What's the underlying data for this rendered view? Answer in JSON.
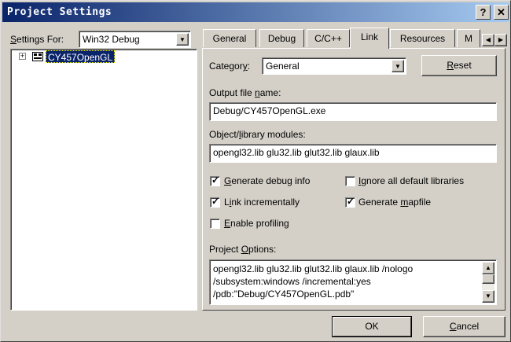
{
  "window": {
    "title": "Project Settings",
    "help": "?",
    "close": "✕"
  },
  "settings_for": {
    "label": "Settings For:",
    "value": "Win32 Debug"
  },
  "tree": {
    "expand": "+",
    "root": "CY457OpenGL"
  },
  "tabs": [
    {
      "label": "General"
    },
    {
      "label": "Debug"
    },
    {
      "label": "C/C++"
    },
    {
      "label": "Link"
    },
    {
      "label": "Resources"
    },
    {
      "label": "M"
    }
  ],
  "tab_scroll": {
    "left": "◀",
    "right": "▶"
  },
  "category": {
    "label": "Category:",
    "value": "General"
  },
  "reset_label": "Reset",
  "output_file": {
    "label": "Output file name:",
    "value": "Debug/CY457OpenGL.exe"
  },
  "modules": {
    "label": "Object/library modules:",
    "value": "opengl32.lib glu32.lib glut32.lib glaux.lib"
  },
  "checkboxes": [
    {
      "label": "Generate debug info"
    },
    {
      "label": "Ignore all default libraries"
    },
    {
      "label": "Link incrementally"
    },
    {
      "label": "Generate mapfile"
    },
    {
      "label": "Enable profiling"
    }
  ],
  "project_options": {
    "label": "Project Options:",
    "lines": [
      "opengl32.lib glu32.lib glut32.lib glaux.lib /nologo",
      "/subsystem:windows /incremental:yes",
      "/pdb:\"Debug/CY457OpenGL.pdb\""
    ]
  },
  "scroll": {
    "up": "▲",
    "down": "▼"
  },
  "ok_label": "OK",
  "cancel_label": "Cancel"
}
